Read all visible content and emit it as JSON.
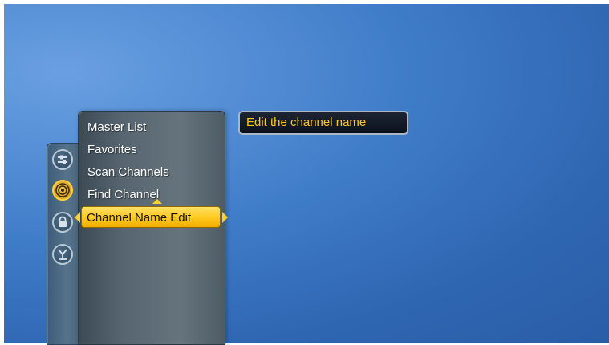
{
  "menu": {
    "items": [
      {
        "label": "Master List",
        "selected": false
      },
      {
        "label": "Favorites",
        "selected": false
      },
      {
        "label": "Scan Channels",
        "selected": false
      },
      {
        "label": "Find Channel",
        "selected": false
      },
      {
        "label": "Channel Name Edit",
        "selected": true
      }
    ]
  },
  "rail": {
    "icons": [
      {
        "name": "sliders-icon",
        "active": false
      },
      {
        "name": "broadcast-antenna-icon",
        "active": true
      },
      {
        "name": "lock-icon",
        "active": false
      },
      {
        "name": "antenna-input-icon",
        "active": false
      }
    ]
  },
  "tooltip": {
    "text": "Edit the channel name"
  },
  "colors": {
    "highlight": "#ffc81e",
    "background": "#3f7cc8",
    "tooltip_text": "#ffc81e"
  }
}
